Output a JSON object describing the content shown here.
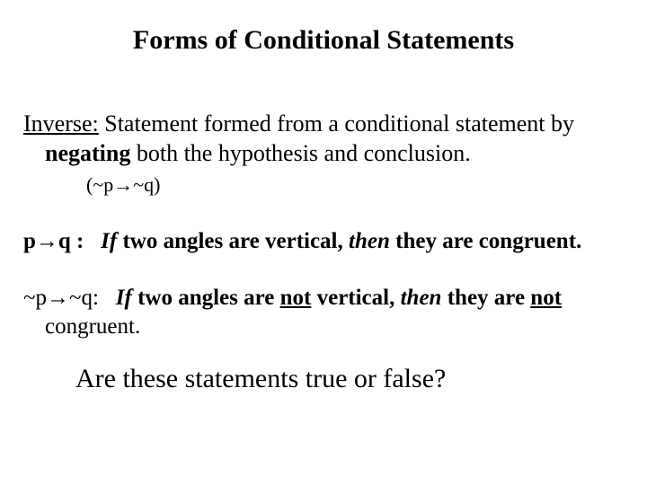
{
  "title": "Forms of Conditional Statements",
  "def": {
    "term": "Inverse:",
    "text1": " Statement formed from a conditional statement by",
    "text2a": "negating",
    "text2b": " both the hypothesis and conclusion."
  },
  "notation": "(~p→~q)",
  "ex1": {
    "label": "p→q :",
    "if": "If",
    "mid": " two angles are vertical, ",
    "then": "then",
    "tail": " they are congruent."
  },
  "ex2": {
    "label": "~p→~q:",
    "if": "If",
    "mid1": " two angles are ",
    "not1": "not",
    "mid2": " vertical, ",
    "then": "then",
    "mid3": " they are ",
    "not2": "not",
    "tail": "congruent."
  },
  "question": "Are these statements true or false?"
}
